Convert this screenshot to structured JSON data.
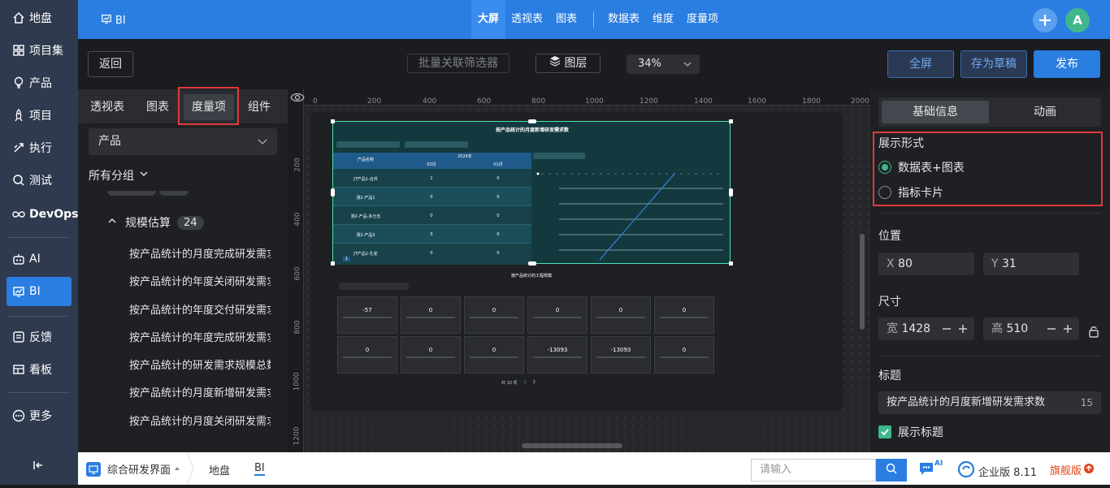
{
  "nav": {
    "items": [
      {
        "label": "地盘",
        "icon": "home-icon"
      },
      {
        "label": "项目集",
        "icon": "grid-icon"
      },
      {
        "label": "产品",
        "icon": "bulb-icon"
      },
      {
        "label": "项目",
        "icon": "rocket-icon"
      },
      {
        "label": "执行",
        "icon": "run-icon"
      },
      {
        "label": "测试",
        "icon": "test-icon"
      },
      {
        "label": "DevOps",
        "icon": "infinity-icon"
      },
      {
        "label": "AI",
        "icon": "robot-icon"
      },
      {
        "label": "BI",
        "icon": "bi-icon"
      },
      {
        "label": "反馈",
        "icon": "feedback-icon"
      },
      {
        "label": "看板",
        "icon": "board-icon"
      },
      {
        "label": "更多",
        "icon": "more-icon"
      }
    ],
    "collapse_icon": "collapse-icon"
  },
  "topbar": {
    "app_label": "BI",
    "tabs": [
      "大屏",
      "透视表",
      "图表",
      "数据表",
      "维度",
      "度量项"
    ],
    "avatar": "A"
  },
  "toolbar": {
    "back": "返回",
    "filter": "批量关联筛选器",
    "layers": "图层",
    "zoom": "34%",
    "fullscreen": "全屏",
    "save_draft": "存为草稿",
    "publish": "发布"
  },
  "leftpanel": {
    "tabs": [
      "透视表",
      "图表",
      "度量项",
      "组件"
    ],
    "product_select": "产品",
    "all_groups": "所有分组",
    "group": {
      "name": "规模估算",
      "count": "24"
    },
    "items": [
      "按产品统计的月度完成研发需求规模",
      "按产品统计的年度关闭研发需求规模",
      "按产品统计的年度交付研发需求规模",
      "按产品统计的年度完成研发需求规模",
      "按产品统计的研发需求规模总数",
      "按产品统计的月度新增研发需求规模",
      "按产品统计的月度关闭研发需求规模"
    ]
  },
  "canvas": {
    "ruler_x": [
      "0",
      "200",
      "400",
      "600",
      "800",
      "1000",
      "1200",
      "1400",
      "1600",
      "1800",
      "2000"
    ],
    "ruler_y": [
      "200",
      "400",
      "600",
      "800",
      "1000",
      "1200"
    ],
    "chart1": {
      "title": "按产品统计的月度新增研发需求数",
      "year": "2024年",
      "col_product": "产品名称",
      "months": [
        "02月",
        "01月"
      ],
      "rows": [
        {
          "name": "JT产品1-合并",
          "v1": "1",
          "v2": "0"
        },
        {
          "name": "测2-产品1",
          "v1": "0",
          "v2": "0"
        },
        {
          "name": "测2-产品-多分支",
          "v1": "0",
          "v2": "0"
        },
        {
          "name": "测2-产品3",
          "v1": "0",
          "v2": "0"
        },
        {
          "name": "JT产品2-孔雀",
          "v1": "0",
          "v2": "0"
        }
      ],
      "pager": "1"
    },
    "chart2": {
      "title": "按产品统计的工程规模",
      "cards_row1": [
        "-57",
        "0",
        "0",
        "0",
        "0",
        "0"
      ],
      "cards_row2": [
        "0",
        "0",
        "0",
        "-13093",
        "-13093",
        "0"
      ],
      "pager_total": "共 10 项",
      "pages": [
        "1",
        "2"
      ]
    }
  },
  "rightpanel": {
    "tabs": [
      "基础信息",
      "动画"
    ],
    "display_title": "展示形式",
    "options": [
      "数据表+图表",
      "指标卡片"
    ],
    "selected_option": 0,
    "position_label": "位置",
    "x_label": "X",
    "x_value": "80",
    "y_label": "Y",
    "y_value": "31",
    "size_label": "尺寸",
    "w_label": "宽",
    "w_value": "1428",
    "h_label": "高",
    "h_value": "510",
    "title_label": "标题",
    "title_value": "按产品统计的月度新增研发需求数",
    "title_count": "15",
    "show_title": "展示标题"
  },
  "bottombar": {
    "workspace": "综合研发界面",
    "crumbs": [
      "地盘",
      "BI"
    ],
    "search_placeholder": "请输入",
    "ai_badge": "AI",
    "edition": "企业版 8.11",
    "flagship": "旗舰版"
  },
  "colors": {
    "brand": "#2a7de1",
    "highlight": "#e03b3b",
    "checked": "#3fb68b"
  }
}
